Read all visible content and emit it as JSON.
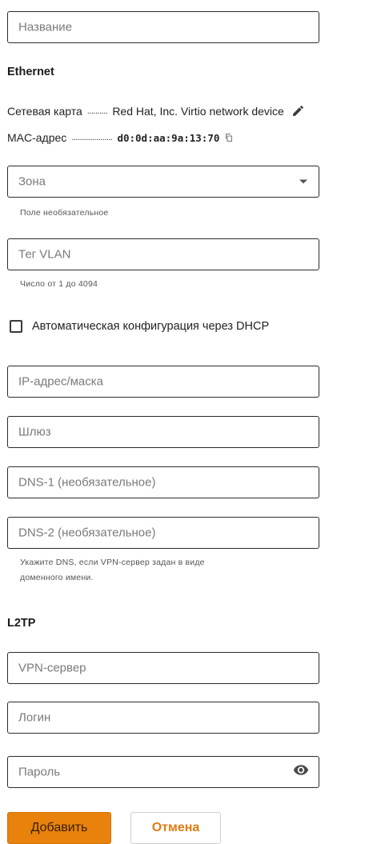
{
  "fields": {
    "name": "Название",
    "zone": "Зона",
    "vlan": "Тег VLAN",
    "ip": "IP-адрес/маска",
    "gateway": "Шлюз",
    "dns1": "DNS-1 (необязательное)",
    "dns2": "DNS-2 (необязательное)",
    "vpn_server": "VPN-сервер",
    "login": "Логин",
    "password": "Пароль"
  },
  "ethernet": {
    "title": "Ethernet",
    "nic_label": "Сетевая карта",
    "nic_dots": "..........",
    "nic_value": "Red Hat, Inc. Virtio network device",
    "mac_label": "MAC-адрес",
    "mac_dots": "....................",
    "mac_value": "d0:0d:aa:9a:13:70"
  },
  "hints": {
    "zone": "Поле необязательное",
    "vlan": "Число от 1 до 4094",
    "dns_line1": "Укажите DNS, если VPN-сервер задан в виде",
    "dns_line2": "доменного имени."
  },
  "dhcp_label": "Автоматическая конфигурация через DHCP",
  "l2tp_title": "L2TP",
  "buttons": {
    "add": "Добавить",
    "cancel": "Отмена"
  },
  "colors": {
    "accent": "#e8820c"
  },
  "icons": {
    "edit": "pencil-icon",
    "copy": "copy-icon",
    "dropdown": "chevron-down-icon",
    "password_visibility": "eye-icon"
  }
}
